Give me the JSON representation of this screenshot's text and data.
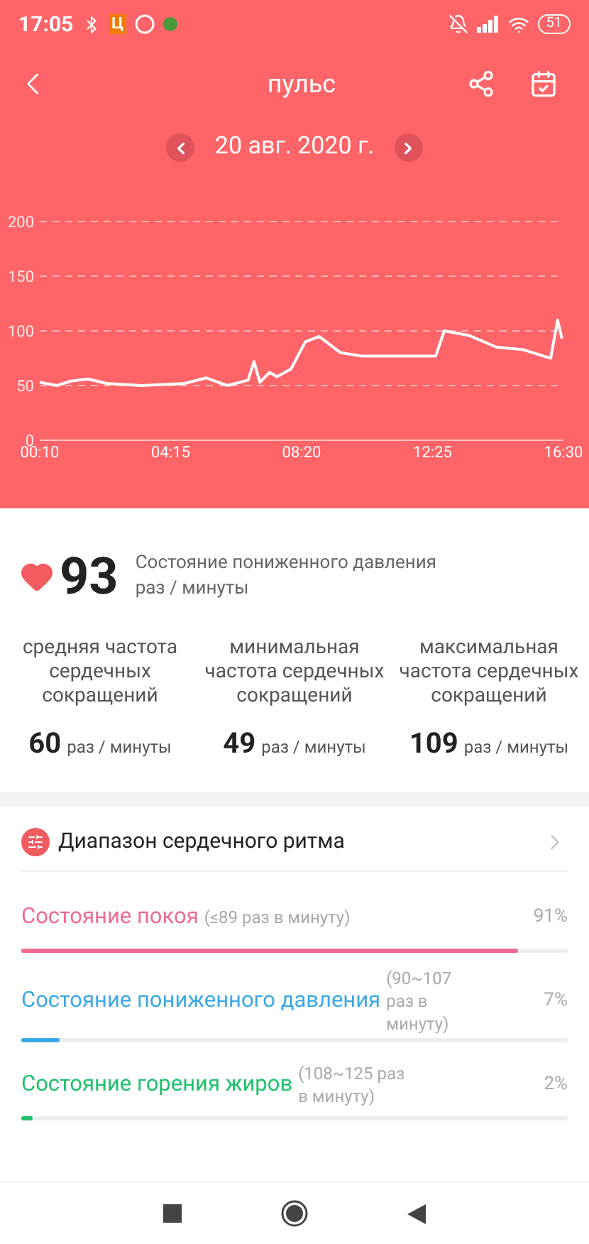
{
  "status_bar": {
    "time": "17:05",
    "app_badge": "Ц",
    "battery": "51"
  },
  "header": {
    "title": "пульс",
    "date": "20 авг. 2020 г."
  },
  "chart": {
    "chart_data": {
      "type": "line",
      "x": [
        10,
        42,
        68,
        100,
        135,
        201,
        281,
        321,
        361,
        400,
        411,
        422,
        440,
        454,
        480,
        507,
        533,
        573,
        613,
        751,
        767,
        812,
        865,
        913,
        966,
        979,
        987
      ],
      "grid": true,
      "series": [
        {
          "color": "#ffffff",
          "values": [
            53,
            50,
            54,
            56,
            52,
            50,
            52,
            57,
            50,
            55,
            72,
            53,
            62,
            58,
            65,
            90,
            95,
            80,
            77,
            77,
            100,
            96,
            85,
            83,
            75,
            110,
            93
          ]
        }
      ],
      "xlim": [
        10,
        990
      ],
      "ylim": [
        0,
        200
      ],
      "xticks": [
        {
          "value": 10,
          "label": "00:10"
        },
        {
          "value": 255,
          "label": "04:15"
        },
        {
          "value": 500,
          "label": "08:20"
        },
        {
          "value": 745,
          "label": "12:25"
        },
        {
          "value": 990,
          "label": "16:30"
        }
      ],
      "yticks": [
        0,
        50,
        100,
        150,
        200
      ]
    }
  },
  "current": {
    "value": "93",
    "state": "Состояние пониженного давления",
    "unit": "раз / минуты"
  },
  "stats": [
    {
      "label": "средняя частота сердечных сокращений",
      "value": "60",
      "unit": "раз / минуты"
    },
    {
      "label": "минимальная частота сердечных сокращений",
      "value": "49",
      "unit": "раз / минуты"
    },
    {
      "label": "максимальная частота сердечных сокращений",
      "value": "109",
      "unit": "раз / минуты"
    }
  ],
  "range_header": "Диапазон сердечного ритма",
  "ranges": [
    {
      "label": "Состояние покоя",
      "range": "(≤89 раз в минуту)",
      "percent": "91%",
      "level": 0.91,
      "color": "#f06b8f"
    },
    {
      "label": "Состояние пониженного давления",
      "range": "(90~107 раз в минуту)",
      "percent": "7%",
      "level": 0.07,
      "color": "#3ba9e6"
    },
    {
      "label": "Состояние горения жиров",
      "range": "(108~125 раз в минуту)",
      "percent": "2%",
      "level": 0.02,
      "color": "#1fc16b"
    }
  ]
}
